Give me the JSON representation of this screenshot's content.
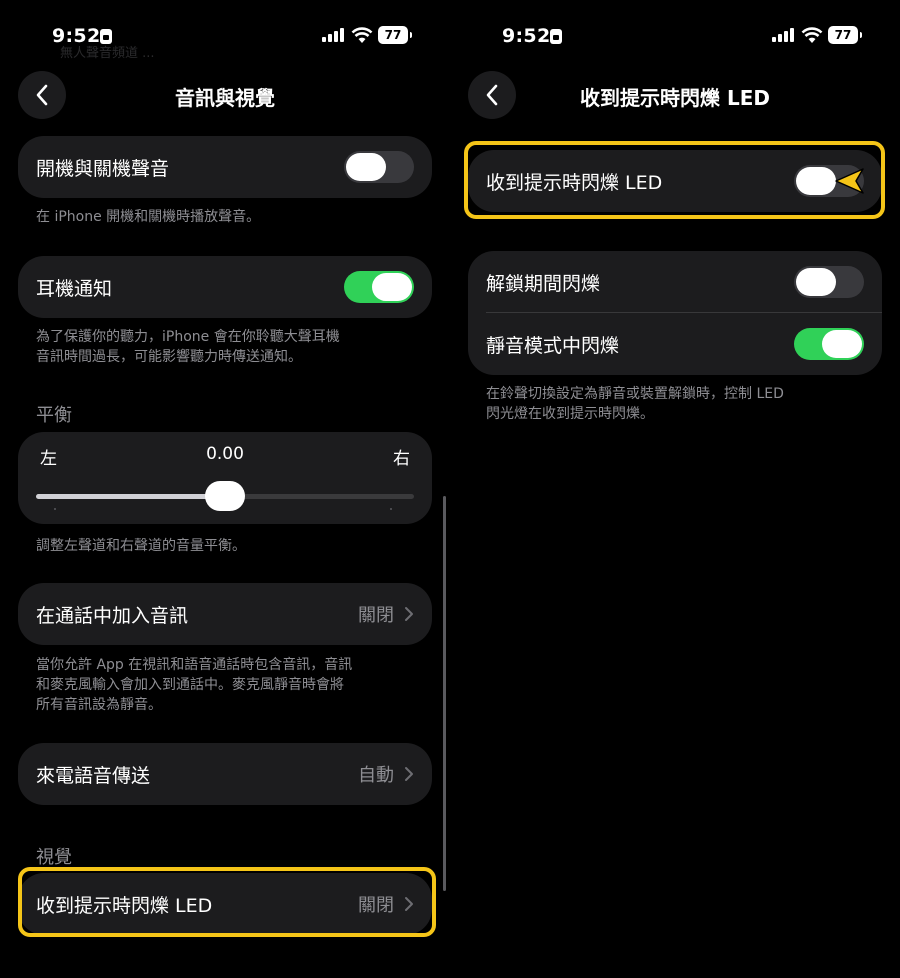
{
  "status_bar": {
    "time": "9:52",
    "battery": "77"
  },
  "left": {
    "nav_title": "音訊與視覺",
    "ghost_text": "無人聲音頻道 ...",
    "startup_sound": {
      "label": "開機與關機聲音",
      "toggle_on": false,
      "footer": "在 iPhone 開機和關機時播放聲音。"
    },
    "headphone_notifications": {
      "label": "耳機通知",
      "toggle_on": true,
      "footer_line1": "為了保護你的聽力，iPhone 會在你聆聽大聲耳機",
      "footer_line2": "音訊時間過長，可能影響聽力時傳送通知。"
    },
    "balance": {
      "header": "平衡",
      "left_label": "左",
      "value": "0.00",
      "right_label": "右",
      "position_fraction": 0.5,
      "footer": "調整左聲道和右聲道的音量平衡。"
    },
    "call_audio": {
      "label": "在通話中加入音訊",
      "value": "關閉",
      "footer_line1": "當你允許 App 在視訊和語音通話時包含音訊，音訊",
      "footer_line2": "和麥克風輸入會加入到通話中。麥克風靜音時會將",
      "footer_line3": "所有音訊設為靜音。"
    },
    "call_routing": {
      "label": "來電語音傳送",
      "value": "自動"
    },
    "visual": {
      "header": "視覺",
      "led_flash": {
        "label": "收到提示時閃爍 LED",
        "value": "關閉"
      }
    }
  },
  "right": {
    "nav_title": "收到提示時閃爍 LED",
    "led_flash": {
      "label": "收到提示時閃爍 LED",
      "toggle_on": false
    },
    "flash_unlocked": {
      "label": "解鎖期間閃爍",
      "toggle_on": false
    },
    "flash_silent": {
      "label": "靜音模式中閃爍",
      "toggle_on": true
    },
    "footer_line1": "在鈴聲切換設定為靜音或裝置解鎖時，控制 LED",
    "footer_line2": "閃光燈在收到提示時閃爍。"
  },
  "colors": {
    "highlight": "#f5c518",
    "toggle_on": "#30d158",
    "toggle_off": "#39393d",
    "cell_bg": "#1c1c1e"
  }
}
